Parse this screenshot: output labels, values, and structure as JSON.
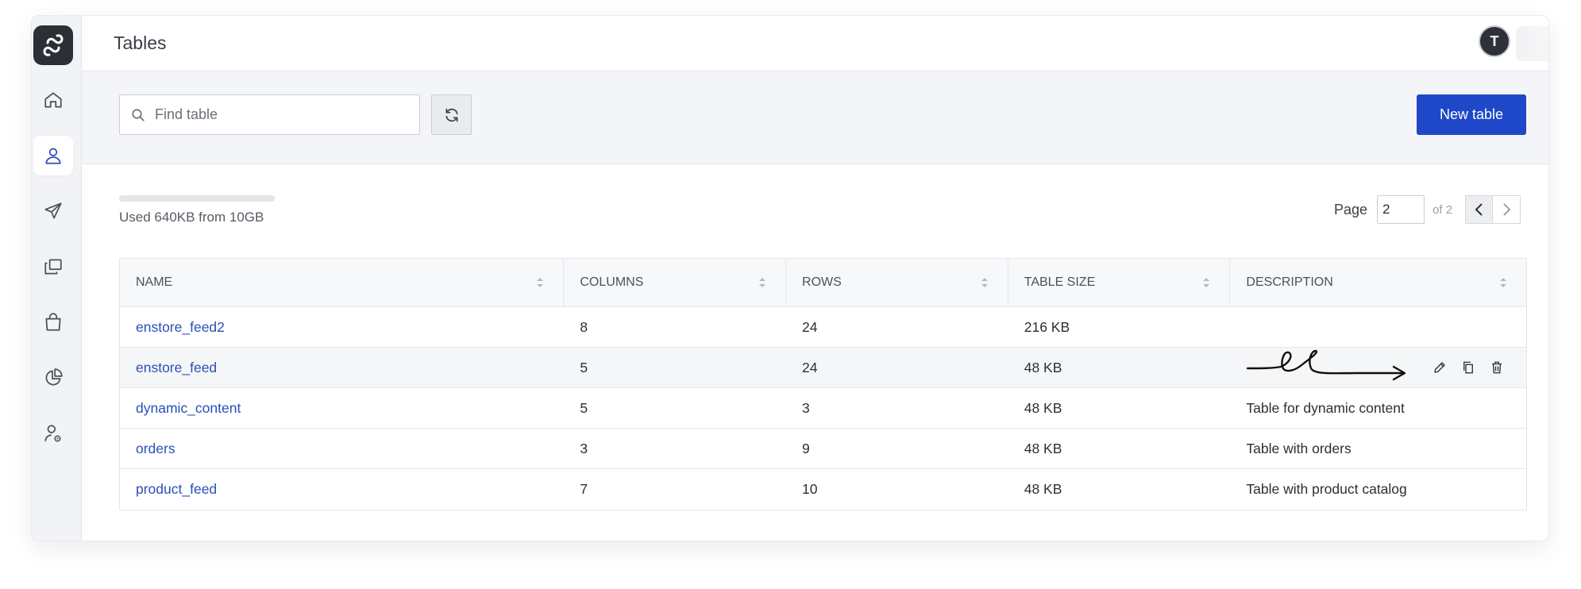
{
  "header": {
    "title": "Tables",
    "avatar_initial": "T"
  },
  "sidebar": {
    "items": [
      {
        "name": "home-icon",
        "active": false
      },
      {
        "name": "user-icon",
        "active": true
      },
      {
        "name": "send-icon",
        "active": false
      },
      {
        "name": "copy-icon",
        "active": false
      },
      {
        "name": "shopping-bag-icon",
        "active": false
      },
      {
        "name": "pie-chart-icon",
        "active": false
      },
      {
        "name": "user-settings-icon",
        "active": false
      }
    ]
  },
  "toolbar": {
    "search_placeholder": "Find table",
    "new_table_label": "New table"
  },
  "usage": {
    "text": "Used 640KB from 10GB",
    "fraction": 0.0001
  },
  "pager": {
    "label": "Page",
    "current": "2",
    "of_text": "of 2"
  },
  "table": {
    "columns": [
      "NAME",
      "COLUMNS",
      "ROWS",
      "TABLE SIZE",
      "DESCRIPTION"
    ],
    "rows": [
      {
        "name": "enstore_feed2",
        "columns": "8",
        "rows": "24",
        "size": "216 KB",
        "description": ""
      },
      {
        "name": "enstore_feed",
        "columns": "5",
        "rows": "24",
        "size": "48 KB",
        "description": ""
      },
      {
        "name": "dynamic_content",
        "columns": "5",
        "rows": "3",
        "size": "48 KB",
        "description": "Table for dynamic content"
      },
      {
        "name": "orders",
        "columns": "3",
        "rows": "9",
        "size": "48 KB",
        "description": "Table with orders"
      },
      {
        "name": "product_feed",
        "columns": "7",
        "rows": "10",
        "size": "48 KB",
        "description": "Table with product catalog"
      }
    ]
  },
  "colors": {
    "accent": "#1e48c8",
    "link": "#2a4fb8",
    "sidebar_bg": "#f2f3f6"
  }
}
